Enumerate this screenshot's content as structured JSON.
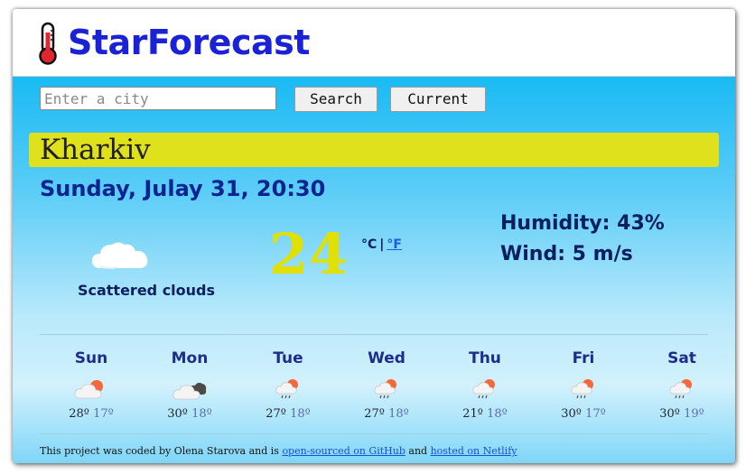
{
  "app": {
    "title": "StarForecast"
  },
  "search": {
    "placeholder": "Enter a city",
    "value": "",
    "search_label": "Search",
    "current_label": "Current"
  },
  "city": "Kharkiv",
  "date": "Sunday, Julay 31, 20:30",
  "current": {
    "icon": "scattered-clouds-icon",
    "condition": "Scattered clouds",
    "temperature": "24",
    "unit_c": "°C",
    "unit_sep": "|",
    "unit_f": "°F",
    "humidity": "Humidity: 43%",
    "wind": "Wind: 5 m/s"
  },
  "forecast": [
    {
      "day": "Sun",
      "max": "28º",
      "min": "17º",
      "icon": "sun-cloud-icon"
    },
    {
      "day": "Mon",
      "max": "30º",
      "min": "18º",
      "icon": "dark-clouds-icon"
    },
    {
      "day": "Tue",
      "max": "27º",
      "min": "18º",
      "icon": "sun-rain-icon"
    },
    {
      "day": "Wed",
      "max": "27º",
      "min": "18º",
      "icon": "sun-rain-icon"
    },
    {
      "day": "Thu",
      "max": "21º",
      "min": "18º",
      "icon": "sun-rain-icon"
    },
    {
      "day": "Fri",
      "max": "30º",
      "min": "17º",
      "icon": "sun-rain-icon"
    },
    {
      "day": "Sat",
      "max": "30º",
      "min": "19º",
      "icon": "sun-rain-icon"
    }
  ],
  "footer": {
    "prefix": "This project was coded by Olena Starova and is",
    "github_link": "open-sourced on GitHub",
    "middle": "and",
    "netlify_link": "hosted on Netlify"
  },
  "colors": {
    "brand": "#1a22d6",
    "city_bar": "#dfe11c",
    "temp": "#e2e000",
    "sky_top": "#19baf4"
  }
}
